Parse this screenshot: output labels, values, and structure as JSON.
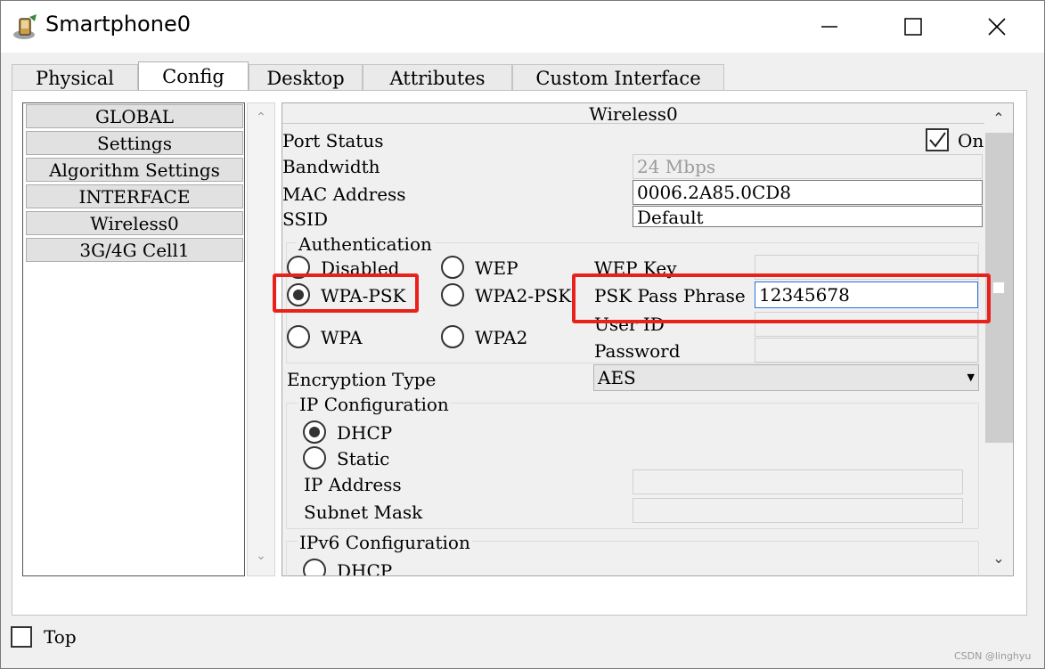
{
  "window": {
    "title": "Smartphone0"
  },
  "tabs": [
    {
      "label": "Physical"
    },
    {
      "label": "Config",
      "active": true
    },
    {
      "label": "Desktop"
    },
    {
      "label": "Attributes"
    },
    {
      "label": "Custom Interface"
    }
  ],
  "nav": {
    "items": [
      {
        "label": "GLOBAL"
      },
      {
        "label": "Settings"
      },
      {
        "label": "Algorithm Settings"
      },
      {
        "label": "INTERFACE"
      },
      {
        "label": "Wireless0"
      },
      {
        "label": "3G/4G Cell1"
      }
    ]
  },
  "wireless": {
    "header": "Wireless0",
    "port_status_label": "Port Status",
    "port_status_on_label": "On",
    "port_status_checked": true,
    "bandwidth_label": "Bandwidth",
    "bandwidth_value": "24 Mbps",
    "mac_label": "MAC Address",
    "mac_value": "0006.2A85.0CD8",
    "ssid_label": "SSID",
    "ssid_value": "Default",
    "auth": {
      "group_label": "Authentication",
      "options": {
        "disabled": "Disabled",
        "wep": "WEP",
        "wpa_psk": "WPA-PSK",
        "wpa2_psk": "WPA2-PSK",
        "wpa": "WPA",
        "wpa2": "WPA2"
      },
      "selected": "WPA-PSK",
      "wep_key_label": "WEP Key",
      "psk_label": "PSK Pass Phrase",
      "psk_value": "12345678",
      "user_id_label": "User ID",
      "password_label": "Password"
    },
    "encryption_label": "Encryption Type",
    "encryption_value": "AES",
    "ip_config": {
      "group_label": "IP Configuration",
      "dhcp_label": "DHCP",
      "static_label": "Static",
      "selected": "DHCP",
      "ip_label": "IP Address",
      "mask_label": "Subnet Mask"
    },
    "ipv6_config": {
      "group_label": "IPv6 Configuration",
      "dhcp_label": "DHCP"
    }
  },
  "footer": {
    "top_label": "Top",
    "watermark": "CSDN @linghyu"
  },
  "colors": {
    "highlight": "#e8221b",
    "focus_border": "#2b6fd6"
  }
}
